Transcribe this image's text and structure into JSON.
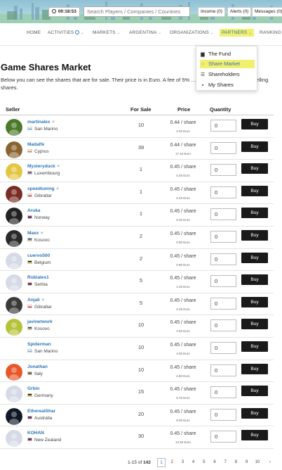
{
  "header": {
    "timer": "00:18:53",
    "search_placeholder": "Search Players / Companies / Countries",
    "income": "Income (0)",
    "alerts": "Alerts (0)",
    "messages": "Messages (0)"
  },
  "nav": {
    "items": [
      {
        "label": "HOME",
        "caret": false
      },
      {
        "label": "ACTIVITIES",
        "caret": true
      },
      {
        "label": "MARKETS",
        "caret": true
      },
      {
        "label": "ARGENTINA",
        "caret": true
      },
      {
        "label": "ORGANIZATIONS",
        "caret": true
      },
      {
        "label": "PARTNERS",
        "caret": true
      },
      {
        "label": "RANKING",
        "caret": false
      }
    ],
    "active": "PARTNERS",
    "caret_glyph": "⌄"
  },
  "dropdown": [
    {
      "label": "The Fund",
      "icon": "bar-chart-icon",
      "glyph": "▆"
    },
    {
      "label": "Share Market",
      "icon": "speech-bubble-icon",
      "glyph": "◌"
    },
    {
      "label": "Shareholders",
      "icon": "list-icon",
      "glyph": "☰"
    },
    {
      "label": "My Shares",
      "icon": "user-icon",
      "glyph": "▪"
    }
  ],
  "page": {
    "title": "Game Shares Market",
    "description": "Below you can see the shares that are for sale. Their price is in Euro. A fee of 5% … fund by the seller when selling shares."
  },
  "table": {
    "headers": {
      "seller": "Seller",
      "for_sale": "For Sale",
      "price": "Price",
      "quantity": "Quantity"
    },
    "buy_label": "Buy",
    "price_suffix": "/ share",
    "rows": [
      {
        "name": "martinalex",
        "gear": true,
        "country": "San Marino",
        "for_sale": "10",
        "price": "0.44",
        "total": "4.40 Euro",
        "qty": "0",
        "avatar": "#4a7a2a",
        "flag": [
          "#ffffff",
          "#6fb6e6"
        ]
      },
      {
        "name": "Madalfe",
        "gear": false,
        "country": "Cyprus",
        "for_sale": "39",
        "price": "0.44",
        "total": "17.16 Euro",
        "qty": "0",
        "avatar": "#8a6430",
        "flag": [
          "#ffffff",
          "#d58a2a"
        ]
      },
      {
        "name": "Mysteryduck",
        "gear": true,
        "country": "Luxembourg",
        "for_sale": "1",
        "price": "0.45",
        "total": "0.45 Euro",
        "qty": "0",
        "avatar": "#e3c640",
        "flag": [
          "#d8353a",
          "#3aa0d8"
        ]
      },
      {
        "name": "speedtuning",
        "gear": true,
        "country": "Gibraltar",
        "for_sale": "1",
        "price": "0.45",
        "total": "0.45 Euro",
        "qty": "0",
        "avatar": "#7a2d25",
        "flag": [
          "#ffffff",
          "#d8353a"
        ]
      },
      {
        "name": "Aruka",
        "gear": false,
        "country": "Norway",
        "for_sale": "1",
        "price": "0.45",
        "total": "0.45 Euro",
        "qty": "0",
        "avatar": "#222222",
        "flag": [
          "#c8283a",
          "#1f3f8a"
        ]
      },
      {
        "name": "Maex",
        "gear": true,
        "country": "Kosovo",
        "for_sale": "2",
        "price": "0.45",
        "total": "0.90 Euro",
        "qty": "0",
        "avatar": "#2a2a2a",
        "flag": [
          "#244aa5",
          "#d8b23a"
        ]
      },
      {
        "name": "cuervo500",
        "gear": false,
        "country": "Belgium",
        "for_sale": "2",
        "price": "0.45",
        "total": "0.90 Euro",
        "qty": "0",
        "avatar": "#d6dae6",
        "flag": [
          "#111111",
          "#f0d030"
        ]
      },
      {
        "name": "Rubiales1",
        "gear": false,
        "country": "Serbia",
        "for_sale": "5",
        "price": "0.45",
        "total": "2.25 Euro",
        "qty": "0",
        "avatar": "#d6dae6",
        "flag": [
          "#c8283a",
          "#1f3f8a"
        ]
      },
      {
        "name": "Anjali",
        "gear": true,
        "country": "Gibraltar",
        "for_sale": "5",
        "price": "0.45",
        "total": "2.25 Euro",
        "qty": "0",
        "avatar": "#3a3a3a",
        "flag": [
          "#ffffff",
          "#d8353a"
        ]
      },
      {
        "name": "javinetwork",
        "gear": false,
        "country": "Kosovo",
        "for_sale": "10",
        "price": "0.45",
        "total": "4.50 Euro",
        "qty": "0",
        "avatar": "#b6c23a",
        "flag": [
          "#244aa5",
          "#d8b23a"
        ]
      },
      {
        "name": "Spiderman",
        "gear": false,
        "country": "San Marino",
        "for_sale": "10",
        "price": "0.45",
        "total": "4.50 Euro",
        "qty": "0",
        "avatar": "#ffffff",
        "flag": [
          "#ffffff",
          "#6fb6e6"
        ]
      },
      {
        "name": "Jonathan",
        "gear": false,
        "country": "Italy",
        "for_sale": "10",
        "price": "0.45",
        "total": "4.50 Euro",
        "qty": "0",
        "avatar": "#e8562a",
        "flag": [
          "#2a9a4a",
          "#d8353a"
        ]
      },
      {
        "name": "Grbin",
        "gear": false,
        "country": "Germany",
        "for_sale": "15",
        "price": "0.45",
        "total": "6.75 Euro",
        "qty": "0",
        "avatar": "#d6dae6",
        "flag": [
          "#111111",
          "#e8b020"
        ]
      },
      {
        "name": "EtherealShar",
        "gear": false,
        "country": "Australia",
        "for_sale": "20",
        "price": "0.45",
        "total": "9.00 Euro",
        "qty": "0",
        "avatar": "#101828",
        "flag": [
          "#1f3f8a",
          "#c8283a"
        ]
      },
      {
        "name": "KOHAN",
        "gear": false,
        "country": "New Zealand",
        "for_sale": "30",
        "price": "0.45",
        "total": "13.50 Euro",
        "qty": "0",
        "avatar": "#d6dae6",
        "flag": [
          "#1f3f8a",
          "#c8283a"
        ]
      }
    ]
  },
  "pagination": {
    "range": "1-15",
    "of": "of",
    "total": "142",
    "pages": [
      "1",
      "2",
      "3",
      "4",
      "5",
      "6",
      "7",
      "8",
      "9",
      "10"
    ],
    "current": "1",
    "next": "›"
  },
  "colors": {
    "link": "#2b76b9",
    "highlight": "#f3ef6e",
    "buy_bg": "#1a1a1a"
  }
}
